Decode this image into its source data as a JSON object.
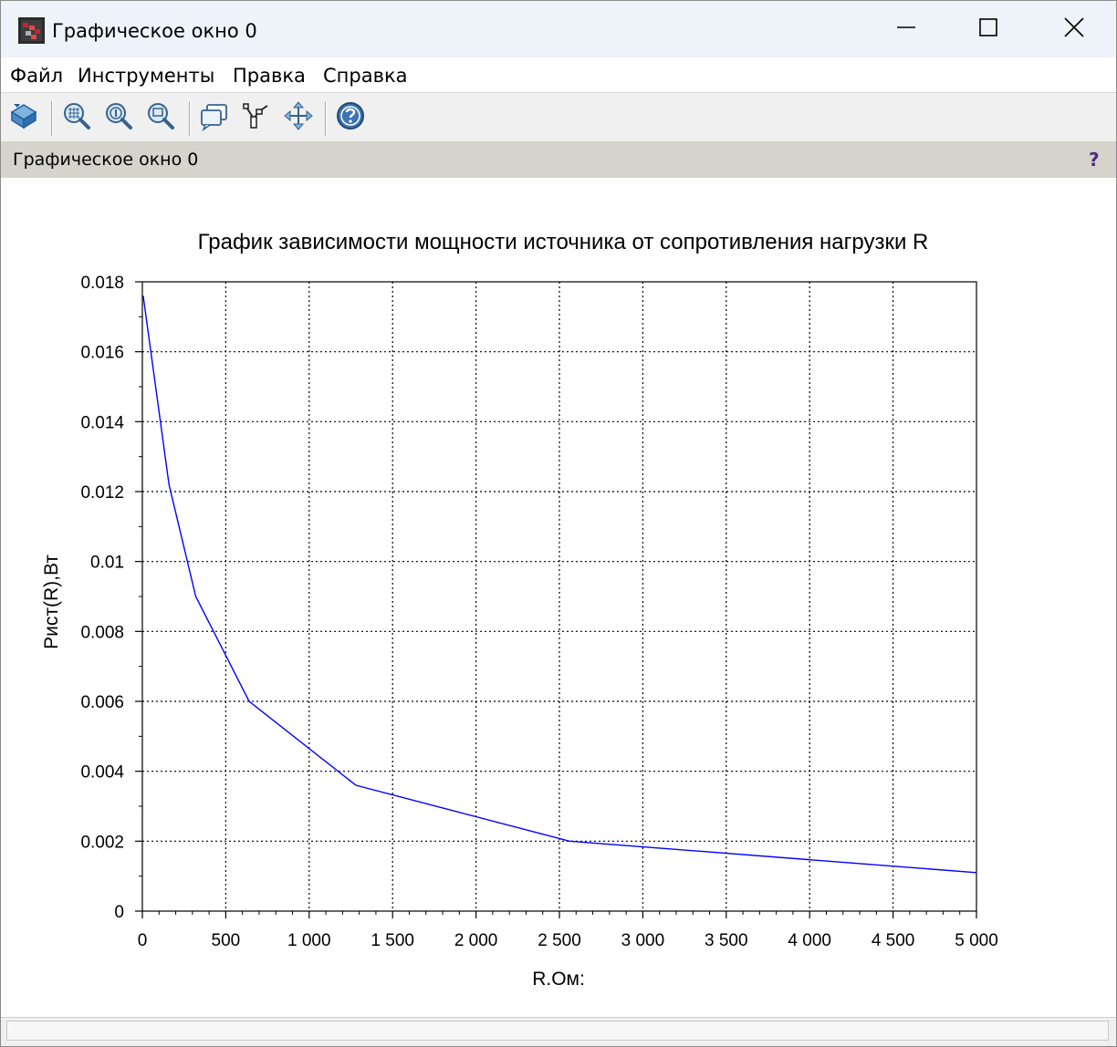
{
  "window": {
    "title": "Графическое окно 0",
    "app_icon": "scilab-graphic-icon",
    "controls": {
      "minimize_icon": "minimize-icon",
      "maximize_icon": "maximize-icon",
      "close_icon": "close-icon"
    }
  },
  "menu": {
    "items": [
      {
        "label": "Файл"
      },
      {
        "label": "Инструменты"
      },
      {
        "label": "Правка"
      },
      {
        "label": "Справка"
      }
    ]
  },
  "toolbar": {
    "buttons": [
      {
        "icon": "rotate-icon"
      },
      {
        "icon": "zoom-icon"
      },
      {
        "icon": "zoom-original-icon"
      },
      {
        "icon": "zoom-region-icon"
      },
      {
        "icon": "datatip-icon"
      },
      {
        "icon": "datatip-editor-icon"
      },
      {
        "icon": "pan-icon"
      },
      {
        "icon": "help-icon"
      }
    ]
  },
  "panel": {
    "title": "Графическое окно 0",
    "help_label": "?"
  },
  "colors": {
    "line": "#0000ff",
    "title_bg": "#eef3fa",
    "panel_bg": "#d6d3cd",
    "toolbar_bg": "#f0f0f0"
  },
  "chart_data": {
    "type": "line",
    "title": "График зависимости мощности источника от сопротивления нагрузки R",
    "xlabel": "R.Ом:",
    "ylabel": "Рист(R),Вт",
    "xlim": [
      0,
      5000
    ],
    "ylim": [
      0,
      0.018
    ],
    "grid": true,
    "x_tick_labels": [
      "0",
      "500",
      "1 000",
      "1 500",
      "2 000",
      "2 500",
      "3 000",
      "3 500",
      "4 000",
      "4 500",
      "5 000"
    ],
    "x_ticks": [
      0,
      500,
      1000,
      1500,
      2000,
      2500,
      3000,
      3500,
      4000,
      4500,
      5000
    ],
    "y_tick_labels": [
      "0",
      "0.002",
      "0.004",
      "0.006",
      "0.008",
      "0.01",
      "0.012",
      "0.014",
      "0.016",
      "0.018"
    ],
    "y_ticks": [
      0,
      0.002,
      0.004,
      0.006,
      0.008,
      0.01,
      0.012,
      0.014,
      0.016,
      0.018
    ],
    "series": [
      {
        "x": [
          5,
          160,
          320,
          640,
          1280,
          2560,
          5000
        ],
        "y": [
          0.0176,
          0.0122,
          0.009,
          0.006,
          0.0036,
          0.002,
          0.0011
        ]
      }
    ]
  }
}
